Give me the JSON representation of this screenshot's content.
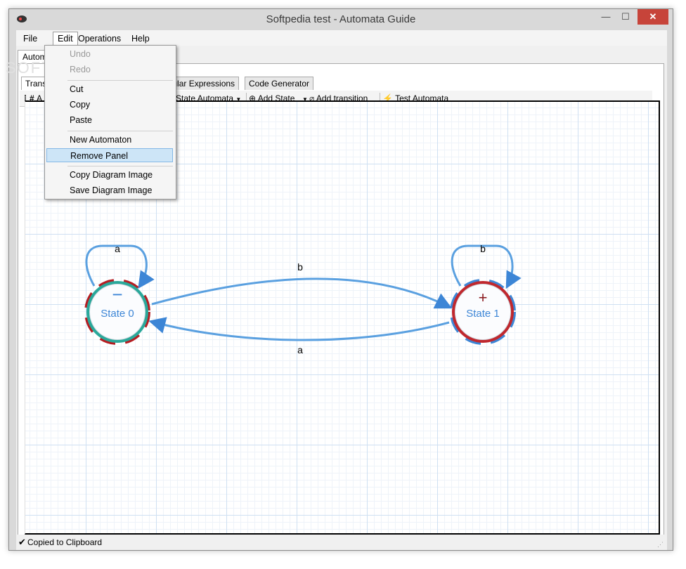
{
  "window": {
    "title": "Softpedia test - Automata Guide"
  },
  "menubar": {
    "items": [
      "File",
      "Edit",
      "Operations",
      "Help"
    ]
  },
  "tabs": {
    "outer": "Autom",
    "inner": [
      "Trans",
      "egular Expressions",
      "Code Generator"
    ]
  },
  "toolbar": {
    "items": [
      "A",
      "e State Automata",
      "Add State",
      "Add transition",
      "Test Automata"
    ]
  },
  "edit_menu": {
    "items": [
      {
        "label": "Undo",
        "enabled": false
      },
      {
        "label": "Redo",
        "enabled": false
      },
      {
        "label": "Cut",
        "enabled": true
      },
      {
        "label": "Copy",
        "enabled": true
      },
      {
        "label": "Paste",
        "enabled": true
      },
      {
        "label": "New Automaton",
        "enabled": true
      },
      {
        "label": "Remove Panel",
        "enabled": true,
        "highlighted": true
      },
      {
        "label": "Copy Diagram Image",
        "enabled": true
      },
      {
        "label": "Save Diagram Image",
        "enabled": true
      }
    ]
  },
  "diagram": {
    "states": [
      {
        "name": "State 0",
        "marker": "−",
        "type": "initial"
      },
      {
        "name": "State 1",
        "marker": "+",
        "type": "final"
      }
    ],
    "transitions": [
      {
        "from": "State 0",
        "to": "State 0",
        "label": "a"
      },
      {
        "from": "State 0",
        "to": "State 1",
        "label": "b"
      },
      {
        "from": "State 1",
        "to": "State 0",
        "label": "a"
      },
      {
        "from": "State 1",
        "to": "State 1",
        "label": "b"
      }
    ]
  },
  "status": {
    "text": "Copied to Clipboard"
  },
  "watermark": "SOFTPEDIA",
  "colors": {
    "accent": "#5aa0e0",
    "initial_ring": "#2aa89a",
    "final_ring": "#c0282e",
    "highlight": "#cde5f7"
  }
}
